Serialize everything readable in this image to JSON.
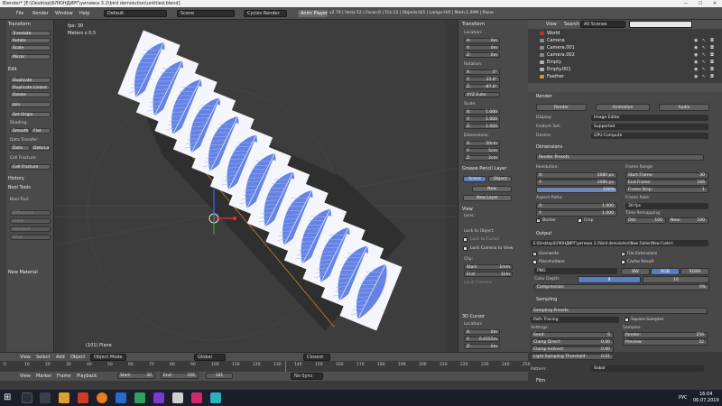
{
  "window": {
    "title": "Blender* [E:\\Desktop\\БЛЮНДИРГ\\уитевка 3.2\\bird demolution\\untitled.blend]",
    "controls": [
      "—",
      "☐",
      "✕"
    ]
  },
  "infobar": {
    "menus": [
      "File",
      "Render",
      "Window",
      "Help"
    ],
    "layout": "Default",
    "scene": "Scene",
    "engine": "Cycles Render",
    "anim_player": "Anim Player",
    "stats": "v2.79 | Verts:12 | Faces:6 | Tris:12 | Objects:0/1 | Lamps:0/0 | Mem:1.00M | Plane"
  },
  "toolshelf": {
    "transform_head": "Transform",
    "transform_buttons": [
      "Translate",
      "Rotate",
      "Scale",
      "Mirror"
    ],
    "edit_head": "Edit",
    "edit_buttons": [
      "Duplicate",
      "Duplicate Linked",
      "Delete",
      "Join"
    ],
    "set_origin": "Set Origin",
    "shading_lbl": "Shading:",
    "smooth": "Smooth",
    "flat": "Flat",
    "data_transfer_lbl": "Data Transfer:",
    "data": "Data",
    "data_la": "Data La",
    "cell_fracture_lbl": "Cell Fracture:",
    "cell_fracture": "Cell Fracture",
    "history_head": "History",
    "bool_tools_head": "Bool Tools",
    "bool_tool_lbl": "Bool Tool:",
    "dim_buttons": [
      "Difference",
      "Union",
      "Intersect",
      "Slice"
    ],
    "new_material": "New Material"
  },
  "viewport": {
    "fps": "fps: 30",
    "meters": "Meters x 0.5",
    "object_label": "(101) Plane"
  },
  "npanel": {
    "transform_head": "Transform",
    "location_lbl": "Location:",
    "location": [
      {
        "k": "X:",
        "v": "0m"
      },
      {
        "k": "Y:",
        "v": "0m"
      },
      {
        "k": "Z:",
        "v": "0m"
      }
    ],
    "rotation_lbl": "Rotation:",
    "rotation": [
      {
        "k": "X:",
        "v": "0°"
      },
      {
        "k": "Y:",
        "v": "22.8°"
      },
      {
        "k": "Z:",
        "v": "-87.8°"
      }
    ],
    "rot_mode": "XYZ Euler",
    "scale_lbl": "Scale:",
    "scale": [
      {
        "k": "X:",
        "v": "1.000"
      },
      {
        "k": "Y:",
        "v": "1.000"
      },
      {
        "k": "Z:",
        "v": "1.000"
      }
    ],
    "dimensions_lbl": "Dimensions:",
    "dimensions": [
      {
        "k": "X:",
        "v": "50cm"
      },
      {
        "k": "Y:",
        "v": "5cm"
      },
      {
        "k": "Z:",
        "v": "2cm"
      }
    ],
    "grease_head": "Grease Pencil Layer",
    "scene_btn": "Scene",
    "object_btn": "Object",
    "new_btn": "New",
    "new_layer_btn": "New Layer",
    "view_head": "View",
    "lens_lbl": "Lens:",
    "lock_to_object": "Lock to Object:",
    "lock_cursor": "Lock to Cursor",
    "lock_camera": "Lock Camera to View",
    "clip_lbl": "Clip:",
    "clip_start": {
      "k": "Start:",
      "v": "1mm"
    },
    "clip_end": {
      "k": "End:",
      "v": "1km"
    },
    "local_camera": "Local Camera",
    "cursor_head": "3D Cursor",
    "cursor_location_lbl": "Location:",
    "cursor": [
      {
        "k": "X:",
        "v": "0m"
      },
      {
        "k": "Y:",
        "v": "0.4555m"
      },
      {
        "k": "Z:",
        "v": "0m"
      }
    ]
  },
  "outliner": {
    "view": "View",
    "search": "Search",
    "filter": "All Scenes",
    "items": [
      "World",
      "Camera",
      "Camera.001",
      "Camera.002",
      "Empty",
      "Empty.001",
      "Feather"
    ]
  },
  "properties": {
    "render_head": "Render",
    "render_btn": "Render",
    "animation_btn": "Animation",
    "audio_btn": "Audio",
    "display_lbl": "Display:",
    "display_val": "Image Editor",
    "feature_lbl": "Feature Set:",
    "feature_val": "Supported",
    "device_lbl": "Device:",
    "device_val": "GPU Compute",
    "dimensions_head": "Dimensions",
    "render_presets": "Render Presets",
    "resolution_lbl": "Resolution:",
    "res_x": {
      "k": "X:",
      "v": "1080 px"
    },
    "res_y": {
      "k": "Y:",
      "v": "1080 px"
    },
    "res_pct": "100%",
    "frame_range_lbl": "Frame Range:",
    "start_frame": {
      "k": "Start Frame:",
      "v": "30"
    },
    "end_frame": {
      "k": "End Frame:",
      "v": "166"
    },
    "frame_step": {
      "k": "Frame Step:",
      "v": "1"
    },
    "aspect_lbl": "Aspect Ratio:",
    "asp_x": {
      "k": "X:",
      "v": "1.000"
    },
    "asp_y": {
      "k": "Y:",
      "v": "1.000"
    },
    "frame_rate_lbl": "Frame Rate:",
    "frame_rate": "30 fps",
    "time_remap_lbl": "Time Remapping:",
    "old": {
      "k": "Old:",
      "v": "100"
    },
    "new": {
      "k": "New:",
      "v": "100"
    },
    "border": "Border",
    "crop": "Crop",
    "output_head": "Output",
    "output_path": "E:\\Desktop\\БЛЮНДИРГ\\уитевка 3.2\\bird demolution\\New Folder\\New Folder\\",
    "overwrite": "Overwrite",
    "file_ext": "File Extensions",
    "placeholders": "Placeholders",
    "cache_result": "Cache Result",
    "format": "PNG",
    "bw": "BW",
    "rgb": "RGB",
    "rgba": "RGBA",
    "color_depth_lbl": "Color Depth:",
    "depth_8": "8",
    "depth_16": "16",
    "compression": {
      "k": "Compression:",
      "v": "0%"
    },
    "sampling_head": "Sampling",
    "sampling_presets": "Sampling Presets",
    "integrator": "Path Tracing",
    "square_samples": "Square Samples",
    "settings_lbl": "Settings:",
    "samples_lbl": "Samples:",
    "seed": {
      "k": "Seed:",
      "v": "0"
    },
    "clamp_direct": {
      "k": "Clamp Direct:",
      "v": "0.00"
    },
    "clamp_indirect": {
      "k": "Clamp Indirect:",
      "v": "0.00"
    },
    "light_threshold": {
      "k": "Light Sampling Threshold:",
      "v": "0.01"
    },
    "render_samples": {
      "k": "Render:",
      "v": "256"
    },
    "preview_samples": {
      "k": "Preview:",
      "v": "32"
    },
    "pattern_lbl": "Pattern:",
    "pattern_val": "Sobol",
    "film_head": "Film"
  },
  "vp_header": {
    "menus": [
      "View",
      "Select",
      "Add",
      "Object"
    ],
    "mode": "Object Mode",
    "pivot": "Global",
    "snap": "Closest"
  },
  "timeline": {
    "ticks": [
      "0",
      "10",
      "20",
      "30",
      "40",
      "50",
      "60",
      "70",
      "80",
      "90",
      "100",
      "110",
      "120",
      "130",
      "140",
      "150",
      "160",
      "170",
      "180",
      "190",
      "200",
      "210",
      "220",
      "230",
      "240",
      "250"
    ],
    "menus": [
      "View",
      "Marker",
      "Frame",
      "Playback"
    ],
    "start": {
      "k": "Start:",
      "v": "30"
    },
    "end": {
      "k": "End:",
      "v": "166"
    },
    "current": "101",
    "sync": "No Sync"
  },
  "taskbar": {
    "lang": "РУС",
    "time": "16:04",
    "date": "06.07.2019"
  },
  "colors": {
    "feather_blue": "#4a6fe0",
    "accent": "#5680c2",
    "selection_orange": "#f08a24"
  }
}
